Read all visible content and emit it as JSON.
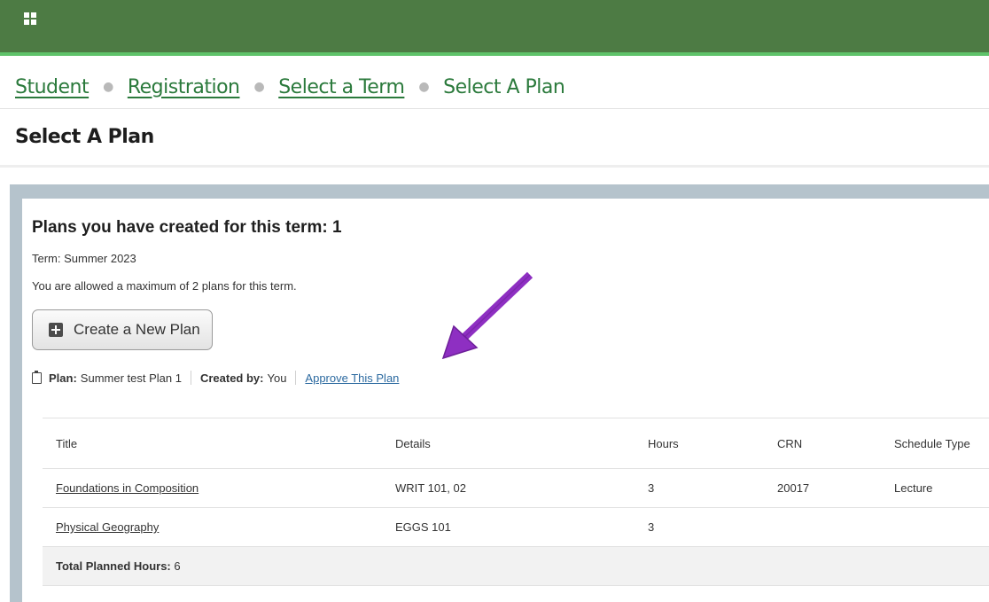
{
  "breadcrumb": {
    "items": [
      "Student",
      "Registration",
      "Select a Term"
    ],
    "current": "Select A Plan"
  },
  "page_title": "Select A Plan",
  "panel": {
    "heading": "Plans you have created for this term: 1",
    "term": "Term: Summer 2023",
    "max_plans": "You are allowed a maximum of 2 plans for this term.",
    "create_button": "Create a New Plan",
    "plan_label": "Plan:",
    "plan_name": "Summer test Plan 1",
    "created_by_label": "Created by:",
    "created_by": "You",
    "approve_link": "Approve This Plan"
  },
  "table": {
    "columns": [
      "Title",
      "Details",
      "Hours",
      "CRN",
      "Schedule Type"
    ],
    "rows": [
      {
        "title": "Foundations in Composition",
        "details": "WRIT 101, 02",
        "hours": "3",
        "crn": "20017",
        "schedule_type": "Lecture"
      },
      {
        "title": "Physical Geography",
        "details": "EGGS 101",
        "hours": "3",
        "crn": "",
        "schedule_type": ""
      }
    ],
    "total_label": "Total Planned Hours:",
    "total_value": "6"
  },
  "colors": {
    "topbar": "#4d7b44",
    "topbar_accent": "#5fc36a",
    "breadcrumb_link": "#2b7a3c",
    "panel_border": "#b5c3cc",
    "approve_link": "#2c6aa0",
    "annotation_arrow": "#8e2fc2"
  },
  "icons": {
    "app_menu": "grid-icon",
    "create": "plus-icon",
    "plan": "clipboard-icon"
  }
}
